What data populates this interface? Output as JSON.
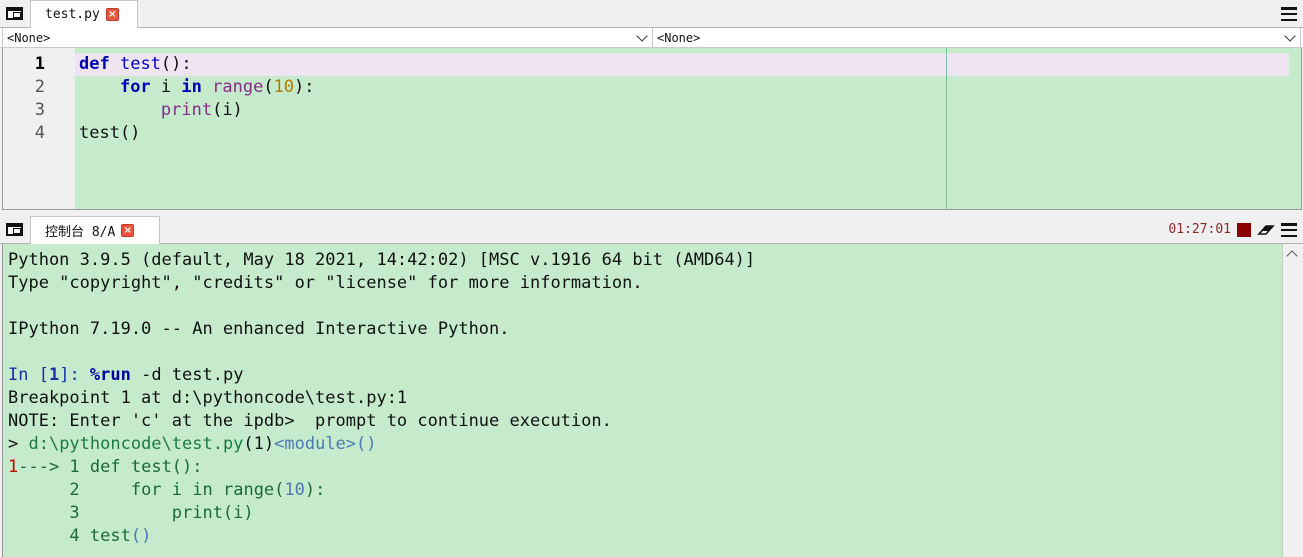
{
  "editor": {
    "tab_label": "test.py",
    "combo_left": "<None>",
    "combo_right": "<None>",
    "line_numbers": [
      "1",
      "2",
      "3",
      "4"
    ],
    "lines": [
      {
        "kw1": "def",
        "sp1": " ",
        "fn": "test",
        "rest": "():"
      },
      {
        "indent": "    ",
        "kw1": "for",
        "mid1": " i ",
        "kw2": "in",
        "sp": " ",
        "bi": "range",
        "p1": "(",
        "num": "10",
        "p2": "):"
      },
      {
        "indent": "        ",
        "bi": "print",
        "rest": "(i)"
      },
      {
        "text": "test()"
      }
    ]
  },
  "console": {
    "tab_label": "控制台 8/A",
    "clock": "01:27:01",
    "lines": {
      "l1": "Python 3.9.5 (default, May 18 2021, 14:42:02) [MSC v.1916 64 bit (AMD64)]",
      "l2": "Type \"copyright\", \"credits\" or \"license\" for more information.",
      "l3": "IPython 7.19.0 -- An enhanced Interactive Python.",
      "in_prompt": "In [",
      "in_num": "1",
      "in_close": "]: ",
      "magic": "%run",
      "cmd": " -d test.py",
      "l5": "Breakpoint 1 at d:\\pythoncode\\test.py:1",
      "l6": "NOTE: Enter 'c' at the ipdb>  prompt to continue execution.",
      "l7_arrow": "> ",
      "l7_path": "d:\\pythoncode\\test.py",
      "l7_lineno": "(1)",
      "l7_module": "<module>",
      "l7_paren": "()",
      "bp_num": "1",
      "bp_arrow": "---> 1 ",
      "tb1_kw": "def",
      "tb1_rest": " test():",
      "tb2_no": "      2     ",
      "tb2_kw1": "for",
      "tb2_mid": " i ",
      "tb2_kw2": "in",
      "tb2_sp": " range(",
      "tb2_num": "10",
      "tb2_end": "):",
      "tb3": "      3         print(i)",
      "tb4_no": "      4 ",
      "tb4_fn": "test",
      "tb4_paren": "()"
    }
  }
}
